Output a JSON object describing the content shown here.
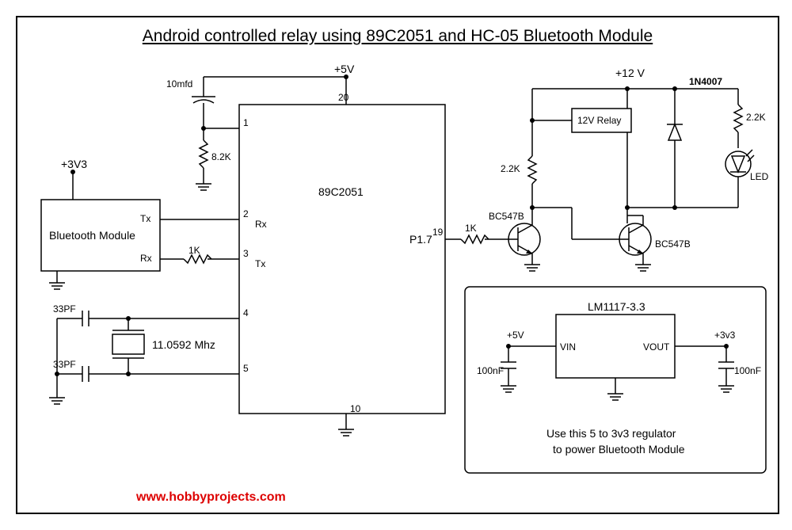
{
  "title": "Android controlled relay using 89C2051 and HC-05 Bluetooth Module",
  "url": "www.hobbyprojects.com",
  "labels": {
    "v5": "+5V",
    "v12": "+12 V",
    "v3v3": "+3V3",
    "v3v3b": "+3v3",
    "cap10": "10mfd",
    "r82k": "8.2K",
    "mcu": "89C2051",
    "bt": "Bluetooth Module",
    "tx": "Tx",
    "rx": "Rx",
    "r1k": "1K",
    "r1k2": "1K",
    "cap33a": "33PF",
    "cap33b": "33PF",
    "crystal": "11.0592 Mhz",
    "pin1": "1",
    "pin2": "2",
    "pin3": "3",
    "pin4": "4",
    "pin5": "5",
    "pin10": "10",
    "pin19": "19",
    "pin20": "20",
    "p17": "P1.7",
    "r22k_a": "2.2K",
    "r22k_b": "2.2K",
    "bc547a": "BC547B",
    "bc547b": "BC547B",
    "relay": "12V Relay",
    "diode": "1N4007",
    "led": "LED",
    "reg": "LM1117-3.3",
    "vin": "VIN",
    "vout": "VOUT",
    "c100a": "100nF",
    "c100b": "100nF",
    "v5b": "+5V",
    "regnote": "Use this 5 to 3v3 regulator\nto power Bluetooth Module"
  }
}
